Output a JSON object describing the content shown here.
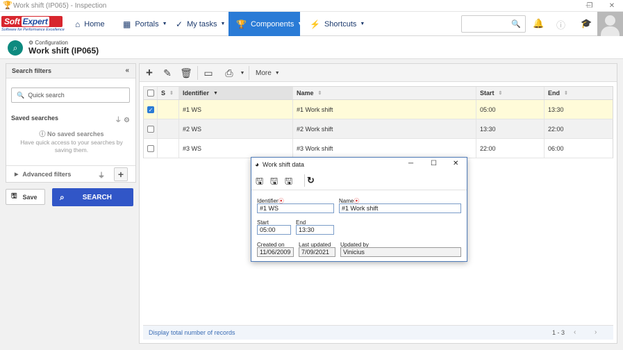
{
  "window": {
    "title": "Work shift (IP065) - Inspection",
    "min": "─",
    "restore": "❐",
    "close": "✕"
  },
  "brand": {
    "name_left": "Soft",
    "name_right": "Expert",
    "tagline": "Software for Performance Excellence"
  },
  "nav": {
    "home": "Home",
    "portals": "Portals",
    "my_tasks": "My tasks",
    "components": "Components",
    "shortcuts": "Shortcuts"
  },
  "header": {
    "crumb": "Configuration",
    "title": "Work shift (IP065)"
  },
  "filters": {
    "title": "Search filters",
    "quick_search_placeholder": "Quick search",
    "saved_searches": "Saved searches",
    "no_saved": "No saved searches",
    "no_saved_hint": "Have quick access to your searches by saving them.",
    "advanced": "Advanced filters",
    "save_label": "Save",
    "search_label": "SEARCH"
  },
  "toolbar": {
    "more_label": "More"
  },
  "grid": {
    "headers": {
      "s": "S",
      "identifier": "Identifier",
      "name": "Name",
      "start": "Start",
      "end": "End"
    },
    "rows": [
      {
        "identifier": "#1 WS",
        "name": "#1 Work shift",
        "start": "05:00",
        "end": "13:30",
        "checked": true
      },
      {
        "identifier": "#2 WS",
        "name": "#2 Work shift",
        "start": "13:30",
        "end": "22:00",
        "checked": false
      },
      {
        "identifier": "#3 WS",
        "name": "#3 Work shift",
        "start": "22:00",
        "end": "06:00",
        "checked": false
      }
    ],
    "footer_link": "Display total number of records",
    "pagination": "1 - 3"
  },
  "dialog": {
    "title": "Work shift data",
    "identifier_label": "Identifier",
    "identifier_value": "#1 WS",
    "name_label": "Name",
    "name_value": "#1 Work shift",
    "start_label": "Start",
    "start_value": "05:00",
    "end_label": "End",
    "end_value": "13:30",
    "created_label": "Created on",
    "created_value": "11/06/2009",
    "updated_label": "Last updated",
    "updated_value": "7/09/2021",
    "updated_by_label": "Updated by",
    "updated_by_value": "Vinicius"
  },
  "colors": {
    "accent": "#2a7bd6",
    "search_button": "#3156c7",
    "selected_row": "#fffbd9",
    "page_icon": "#0d8a7f"
  }
}
